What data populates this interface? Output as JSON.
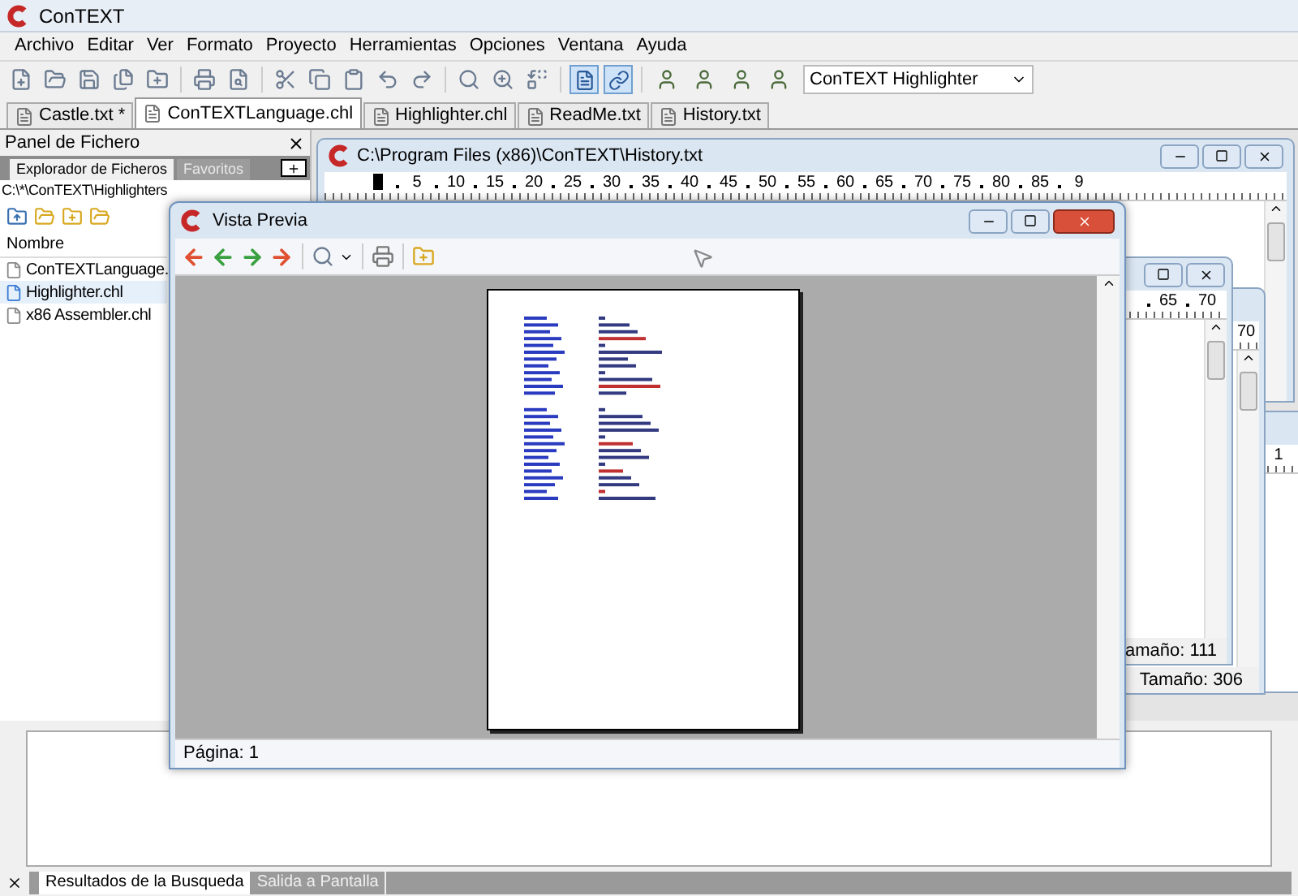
{
  "app": {
    "title": "ConTEXT"
  },
  "menu": [
    "Archivo",
    "Editar",
    "Ver",
    "Formato",
    "Proyecto",
    "Herramientas",
    "Opciones",
    "Ventana",
    "Ayuda"
  ],
  "toolbar": {
    "highlighter": "ConTEXT Highlighter"
  },
  "doc_tabs": [
    {
      "label": "Castle.txt *",
      "selected": false
    },
    {
      "label": "ConTEXTLanguage.chl",
      "selected": true
    },
    {
      "label": "Highlighter.chl",
      "selected": false
    },
    {
      "label": "ReadMe.txt",
      "selected": false
    },
    {
      "label": "History.txt",
      "selected": false
    }
  ],
  "file_panel": {
    "title": "Panel de Fichero",
    "tabs": [
      {
        "label": "Explorador de Ficheros",
        "selected": true
      },
      {
        "label": "Favoritos",
        "selected": false
      }
    ],
    "path": "C:\\*\\ConTEXT\\Highlighters",
    "column": "Nombre",
    "files": [
      {
        "name": "ConTEXTLanguage.",
        "selected": false
      },
      {
        "name": "Highlighter.chl",
        "selected": true
      },
      {
        "name": "x86 Assembler.chl",
        "selected": false
      }
    ]
  },
  "editor_windows": [
    {
      "title": "C:\\Program Files (x86)\\ConTEXT\\History.txt",
      "ruler": [
        "5",
        "10",
        "15",
        "20",
        "25",
        "30",
        "35",
        "40",
        "45",
        "50",
        "55",
        "60",
        "65",
        "70",
        "75",
        "80",
        "85",
        "9"
      ]
    },
    {
      "ruler": [
        "65",
        "70"
      ],
      "status": "amaño: 111"
    },
    {
      "ruler": [
        "70"
      ],
      "status": "Tamaño: 306"
    },
    {
      "ruler": [
        "1"
      ]
    }
  ],
  "preview": {
    "title": "Vista Previa",
    "status": "Página: 1"
  },
  "output": {
    "tabs": [
      {
        "label": "Resultados de la Busqueda",
        "selected": true
      },
      {
        "label": "Salida a Pantalla",
        "selected": false
      }
    ]
  }
}
